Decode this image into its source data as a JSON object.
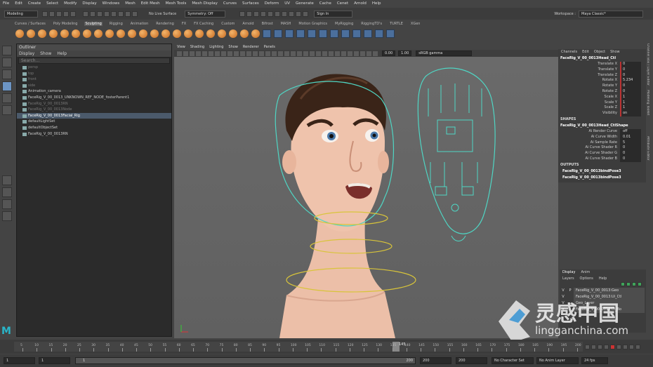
{
  "menu": [
    "File",
    "Edit",
    "Create",
    "Select",
    "Modify",
    "Display",
    "Windows",
    "Mesh",
    "Edit Mesh",
    "Mesh Tools",
    "Mesh Display",
    "Curves",
    "Surfaces",
    "Deform",
    "UV",
    "Generate",
    "Cache",
    "Cenet",
    "Arnold",
    "Help"
  ],
  "status": {
    "mode": "Modeling",
    "live_surface": "No Live Surface",
    "symmetry": "Symmetry: Off",
    "sign_in": "Sign In",
    "workspace_label": "Workspace :",
    "workspace": "Maya Classic*"
  },
  "shelf_tabs": [
    "Curves / Surfaces",
    "Poly Modeling",
    "Sculpting",
    "Rigging",
    "Animation",
    "Rendering",
    "FX",
    "FX Caching",
    "Custom",
    "Arnold",
    "Bifrost",
    "MASH",
    "Motion Graphics",
    "MyRigging",
    "RiggingTD's",
    "TURTLE",
    "XGen"
  ],
  "outliner": {
    "title": "Outliner",
    "menus": [
      "Display",
      "Show",
      "Help"
    ],
    "search": "Search...",
    "items": [
      {
        "label": "persp",
        "dim": true,
        "sel": false
      },
      {
        "label": "top",
        "dim": true,
        "sel": false
      },
      {
        "label": "front",
        "dim": true,
        "sel": false
      },
      {
        "label": "side",
        "dim": true,
        "sel": false
      },
      {
        "label": "Animation_camera",
        "dim": false,
        "sel": false
      },
      {
        "label": "FaceRig_V_00_0013_UNKNOWN_REF_NODE_fosterParent1",
        "dim": false,
        "sel": false
      },
      {
        "label": "FaceRig_V_00_0013RN",
        "dim": true,
        "sel": false
      },
      {
        "label": "FaceRig_V_00_0013Node",
        "dim": true,
        "sel": false
      },
      {
        "label": "FaceRig_V_00_0013Facial_Rig",
        "dim": false,
        "sel": true
      },
      {
        "label": "defaultLightSet",
        "dim": false,
        "sel": false
      },
      {
        "label": "defaultObjectSet",
        "dim": false,
        "sel": false
      },
      {
        "label": "FaceRig_V_00_0013RN",
        "dim": false,
        "sel": false
      }
    ]
  },
  "viewport": {
    "menus": [
      "View",
      "Shading",
      "Lighting",
      "Show",
      "Renderer",
      "Panels"
    ],
    "exposure": "0.00",
    "gamma": "1.00",
    "colorspace": "sRGB gamma"
  },
  "channel_box": {
    "menus": [
      "Channels",
      "Edit",
      "Object",
      "Show"
    ],
    "object": "FaceRig_V_00_0013Head_Ctl",
    "attrs": [
      {
        "name": "Translate X",
        "value": "0"
      },
      {
        "name": "Translate Y",
        "value": "0"
      },
      {
        "name": "Translate Z",
        "value": "0"
      },
      {
        "name": "Rotate X",
        "value": "5.234"
      },
      {
        "name": "Rotate Y",
        "value": "0"
      },
      {
        "name": "Rotate Z",
        "value": "0"
      },
      {
        "name": "Scale X",
        "value": "1"
      },
      {
        "name": "Scale Y",
        "value": "1"
      },
      {
        "name": "Scale Z",
        "value": "1"
      },
      {
        "name": "Visibility",
        "value": "on"
      }
    ],
    "shapes_label": "SHAPES",
    "shape_name": "FaceRig_V_00_0013Head_CtlShape",
    "shape_attrs": [
      {
        "name": "Ai Render Curve",
        "value": "off"
      },
      {
        "name": "Ai Curve Width",
        "value": "0.01"
      },
      {
        "name": "Ai Sample Rate",
        "value": "5"
      },
      {
        "name": "Ai Curve Shader R",
        "value": "0"
      },
      {
        "name": "Ai Curve Shader G",
        "value": "0"
      },
      {
        "name": "Ai Curve Shader B",
        "value": "0"
      }
    ],
    "outputs_label": "OUTPUTS",
    "outputs": [
      "FaceRig_V_00_0013bindPose3",
      "FaceRig_V_00_0013bindPose3"
    ]
  },
  "layers": {
    "tabs": [
      "Display",
      "Anim"
    ],
    "menus": [
      "Layers",
      "Options",
      "Help"
    ],
    "rows": [
      {
        "v": "V",
        "p": "P",
        "name": "FaceRig_V_00_0013:Geo"
      },
      {
        "v": "V",
        "p": "",
        "name": "FaceRig_V_00_0013:Ui_Ctl"
      },
      {
        "v": "V",
        "p": "",
        "name": "Geo_Layer"
      },
      {
        "v": "V",
        "p": "",
        "name": "FaceRig_V_00_0013:Ui_Bo"
      }
    ]
  },
  "timeline": {
    "ticks": [
      "5",
      "10",
      "15",
      "20",
      "25",
      "30",
      "35",
      "40",
      "45",
      "50",
      "55",
      "60",
      "65",
      "70",
      "75",
      "80",
      "85",
      "90",
      "95",
      "100",
      "105",
      "110",
      "115",
      "120",
      "125",
      "130",
      "135",
      "140",
      "145",
      "150",
      "155",
      "160",
      "165",
      "170",
      "175",
      "180",
      "185",
      "190",
      "195",
      "200"
    ],
    "current": "145"
  },
  "range": {
    "start": "1",
    "start2": "1",
    "slider_value": "1",
    "end_inner": "200",
    "end": "200",
    "end2": "200",
    "char_set": "No Character Set",
    "anim_layer": "No Anim Layer",
    "fps": "24 fps"
  },
  "right_tabs": [
    "Channel Box / Layer Editor",
    "Modeling Toolkit",
    "Attribute Editor"
  ],
  "watermark": {
    "brand": "灵感中国",
    "url": "lingganchina.com"
  },
  "colors": {
    "accent": "#6c95c5",
    "rig_curve": "#4fd6c4",
    "ring": "#d8c43a",
    "skin": "#e8b9a2",
    "hair": "#3a2418",
    "logo": "#29b5c9"
  }
}
